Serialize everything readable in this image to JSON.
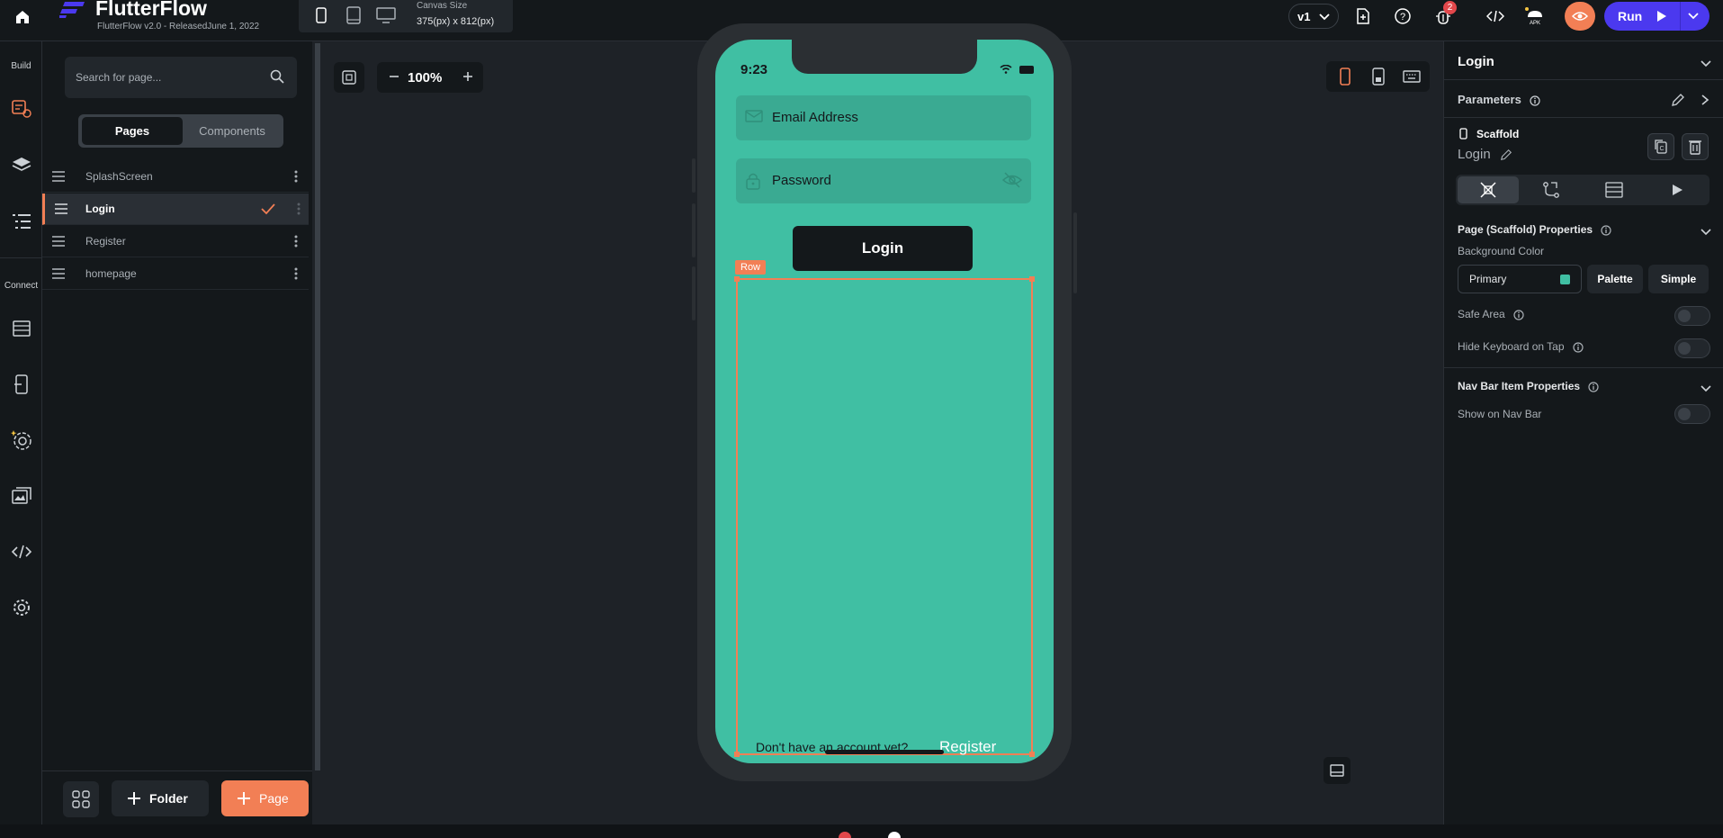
{
  "app": {
    "name": "FlutterFlow",
    "release": "FlutterFlow v2.0 - ReleasedJune 1, 2022",
    "canvas_size_label": "Canvas Size",
    "canvas_size_value": "375(px) x 812(px)",
    "version": "v1",
    "notification_count": "2",
    "run_label": "Run",
    "accent": "#f27f55",
    "run_color": "#4b39ef"
  },
  "rail": {
    "build_label": "Build",
    "connect_label": "Connect"
  },
  "pages_panel": {
    "search_placeholder": "Search for page...",
    "tabs": {
      "pages": "Pages",
      "components": "Components"
    },
    "pages": [
      {
        "name": "SplashScreen"
      },
      {
        "name": "Login"
      },
      {
        "name": "Register"
      },
      {
        "name": "homepage"
      }
    ],
    "folder_button": "Folder",
    "page_button": "Page"
  },
  "canvas": {
    "zoom": "100%"
  },
  "phone": {
    "time": "9:23",
    "email_label": "Email Address",
    "password_label": "Password",
    "login_button": "Login",
    "row_tag": "Row",
    "no_account_text": "Don't have an account yet?",
    "register_link": "Register",
    "background": "#40bfa3"
  },
  "properties": {
    "title": "Login",
    "parameters_label": "Parameters",
    "scaffold_label": "Scaffold",
    "scaffold_name": "Login",
    "page_props_title": "Page (Scaffold) Properties",
    "background_color_label": "Background Color",
    "background_color_value": "Primary",
    "palette_button": "Palette",
    "simple_button": "Simple",
    "safe_area_label": "Safe Area",
    "hide_keyboard_label": "Hide Keyboard on Tap",
    "nav_bar_title": "Nav Bar Item Properties",
    "show_nav_bar_label": "Show on Nav Bar"
  }
}
